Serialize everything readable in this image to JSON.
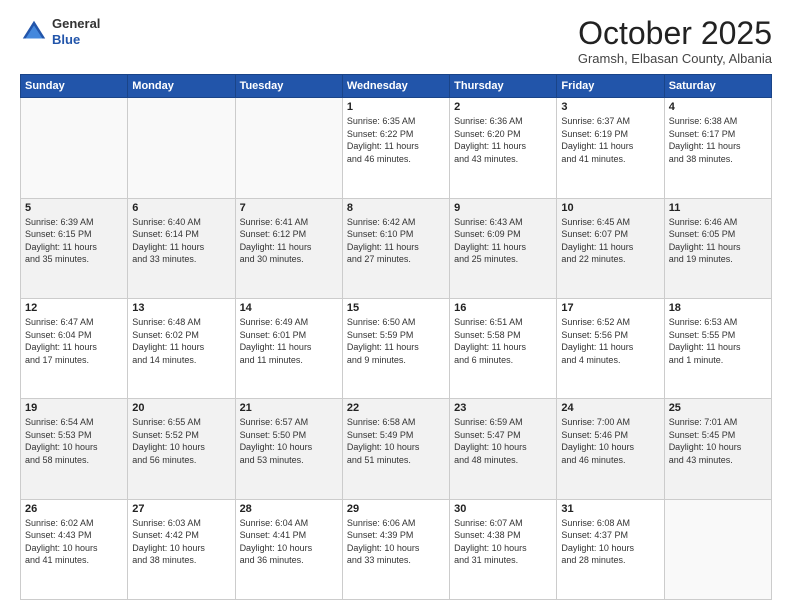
{
  "header": {
    "logo_general": "General",
    "logo_blue": "Blue",
    "month_title": "October 2025",
    "subtitle": "Gramsh, Elbasan County, Albania"
  },
  "weekdays": [
    "Sunday",
    "Monday",
    "Tuesday",
    "Wednesday",
    "Thursday",
    "Friday",
    "Saturday"
  ],
  "weeks": [
    [
      {
        "day": "",
        "info": ""
      },
      {
        "day": "",
        "info": ""
      },
      {
        "day": "",
        "info": ""
      },
      {
        "day": "1",
        "info": "Sunrise: 6:35 AM\nSunset: 6:22 PM\nDaylight: 11 hours\nand 46 minutes."
      },
      {
        "day": "2",
        "info": "Sunrise: 6:36 AM\nSunset: 6:20 PM\nDaylight: 11 hours\nand 43 minutes."
      },
      {
        "day": "3",
        "info": "Sunrise: 6:37 AM\nSunset: 6:19 PM\nDaylight: 11 hours\nand 41 minutes."
      },
      {
        "day": "4",
        "info": "Sunrise: 6:38 AM\nSunset: 6:17 PM\nDaylight: 11 hours\nand 38 minutes."
      }
    ],
    [
      {
        "day": "5",
        "info": "Sunrise: 6:39 AM\nSunset: 6:15 PM\nDaylight: 11 hours\nand 35 minutes."
      },
      {
        "day": "6",
        "info": "Sunrise: 6:40 AM\nSunset: 6:14 PM\nDaylight: 11 hours\nand 33 minutes."
      },
      {
        "day": "7",
        "info": "Sunrise: 6:41 AM\nSunset: 6:12 PM\nDaylight: 11 hours\nand 30 minutes."
      },
      {
        "day": "8",
        "info": "Sunrise: 6:42 AM\nSunset: 6:10 PM\nDaylight: 11 hours\nand 27 minutes."
      },
      {
        "day": "9",
        "info": "Sunrise: 6:43 AM\nSunset: 6:09 PM\nDaylight: 11 hours\nand 25 minutes."
      },
      {
        "day": "10",
        "info": "Sunrise: 6:45 AM\nSunset: 6:07 PM\nDaylight: 11 hours\nand 22 minutes."
      },
      {
        "day": "11",
        "info": "Sunrise: 6:46 AM\nSunset: 6:05 PM\nDaylight: 11 hours\nand 19 minutes."
      }
    ],
    [
      {
        "day": "12",
        "info": "Sunrise: 6:47 AM\nSunset: 6:04 PM\nDaylight: 11 hours\nand 17 minutes."
      },
      {
        "day": "13",
        "info": "Sunrise: 6:48 AM\nSunset: 6:02 PM\nDaylight: 11 hours\nand 14 minutes."
      },
      {
        "day": "14",
        "info": "Sunrise: 6:49 AM\nSunset: 6:01 PM\nDaylight: 11 hours\nand 11 minutes."
      },
      {
        "day": "15",
        "info": "Sunrise: 6:50 AM\nSunset: 5:59 PM\nDaylight: 11 hours\nand 9 minutes."
      },
      {
        "day": "16",
        "info": "Sunrise: 6:51 AM\nSunset: 5:58 PM\nDaylight: 11 hours\nand 6 minutes."
      },
      {
        "day": "17",
        "info": "Sunrise: 6:52 AM\nSunset: 5:56 PM\nDaylight: 11 hours\nand 4 minutes."
      },
      {
        "day": "18",
        "info": "Sunrise: 6:53 AM\nSunset: 5:55 PM\nDaylight: 11 hours\nand 1 minute."
      }
    ],
    [
      {
        "day": "19",
        "info": "Sunrise: 6:54 AM\nSunset: 5:53 PM\nDaylight: 10 hours\nand 58 minutes."
      },
      {
        "day": "20",
        "info": "Sunrise: 6:55 AM\nSunset: 5:52 PM\nDaylight: 10 hours\nand 56 minutes."
      },
      {
        "day": "21",
        "info": "Sunrise: 6:57 AM\nSunset: 5:50 PM\nDaylight: 10 hours\nand 53 minutes."
      },
      {
        "day": "22",
        "info": "Sunrise: 6:58 AM\nSunset: 5:49 PM\nDaylight: 10 hours\nand 51 minutes."
      },
      {
        "day": "23",
        "info": "Sunrise: 6:59 AM\nSunset: 5:47 PM\nDaylight: 10 hours\nand 48 minutes."
      },
      {
        "day": "24",
        "info": "Sunrise: 7:00 AM\nSunset: 5:46 PM\nDaylight: 10 hours\nand 46 minutes."
      },
      {
        "day": "25",
        "info": "Sunrise: 7:01 AM\nSunset: 5:45 PM\nDaylight: 10 hours\nand 43 minutes."
      }
    ],
    [
      {
        "day": "26",
        "info": "Sunrise: 6:02 AM\nSunset: 4:43 PM\nDaylight: 10 hours\nand 41 minutes."
      },
      {
        "day": "27",
        "info": "Sunrise: 6:03 AM\nSunset: 4:42 PM\nDaylight: 10 hours\nand 38 minutes."
      },
      {
        "day": "28",
        "info": "Sunrise: 6:04 AM\nSunset: 4:41 PM\nDaylight: 10 hours\nand 36 minutes."
      },
      {
        "day": "29",
        "info": "Sunrise: 6:06 AM\nSunset: 4:39 PM\nDaylight: 10 hours\nand 33 minutes."
      },
      {
        "day": "30",
        "info": "Sunrise: 6:07 AM\nSunset: 4:38 PM\nDaylight: 10 hours\nand 31 minutes."
      },
      {
        "day": "31",
        "info": "Sunrise: 6:08 AM\nSunset: 4:37 PM\nDaylight: 10 hours\nand 28 minutes."
      },
      {
        "day": "",
        "info": ""
      }
    ]
  ]
}
